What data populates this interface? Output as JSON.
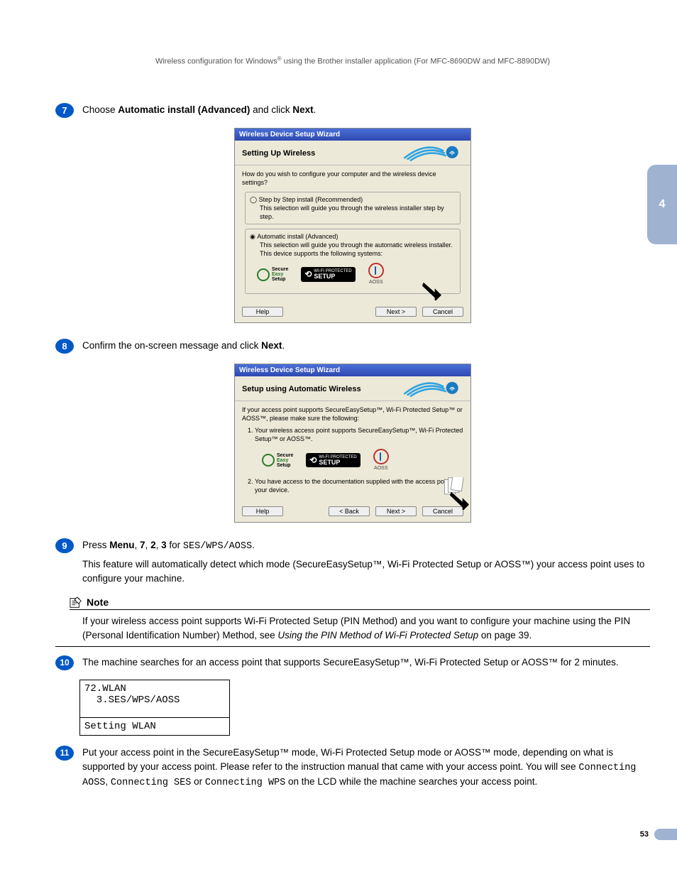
{
  "header": {
    "text_a": "Wireless configuration for Windows",
    "text_b": " using the Brother installer application (For MFC-8690DW and MFC-8890DW)"
  },
  "chapter_tab": "4",
  "page_number": "53",
  "steps": {
    "s7": {
      "num": "7",
      "text_a": "Choose ",
      "bold_a": "Automatic install (Advanced)",
      "text_b": " and click ",
      "bold_b": "Next",
      "text_c": "."
    },
    "s8": {
      "num": "8",
      "text_a": "Confirm the on-screen message and click ",
      "bold_a": "Next",
      "text_b": "."
    },
    "s9": {
      "num": "9",
      "line1_a": "Press ",
      "line1_b1": "Menu",
      "line1_sep1": ", ",
      "line1_b2": "7",
      "line1_sep2": ", ",
      "line1_b3": "2",
      "line1_sep3": ", ",
      "line1_b4": "3",
      "line1_c": " for ",
      "mono": "SES/WPS/AOSS",
      "line1_end": ".",
      "line2": "This feature will automatically detect which mode (SecureEasySetup™, Wi-Fi Protected Setup or AOSS™) your access point uses to configure your machine."
    },
    "s10": {
      "num": "10",
      "text": "The machine searches for an access point that supports SecureEasySetup™, Wi-Fi Protected Setup or AOSS™ for 2 minutes."
    },
    "s11": {
      "num": "11",
      "a": "Put your access point in the SecureEasySetup™ mode, Wi-Fi Protected Setup mode or AOSS™ mode, depending on what is supported by your access point. Please refer to the instruction manual that came with your access point. You will see ",
      "m1": "Connecting AOSS",
      "sep1": ", ",
      "m2": "Connecting SES",
      "sep2": " or ",
      "m3": "Connecting WPS",
      "b": " on the LCD while the machine searches your access point."
    }
  },
  "note": {
    "title": "Note",
    "a": "If your wireless access point supports Wi-Fi Protected Setup (PIN Method) and you want to configure your machine using the PIN (Personal Identification Number) Method, see ",
    "italic": "Using the PIN Method of Wi-Fi Protected Setup",
    "b": " on page 39."
  },
  "dialog1": {
    "title": "Wireless Device Setup Wizard",
    "heading": "Setting Up Wireless",
    "q": "How do you wish to configure your computer and the wireless device settings?",
    "opt1_label": "Step by Step install (Recommended)",
    "opt1_desc": "This selection will guide you through the wireless installer step by step.",
    "opt2_label": "Automatic install (Advanced)",
    "opt2_desc1": "This selection will guide you through the automatic wireless installer.",
    "opt2_desc2": "This device supports the following systems:",
    "btn_help": "Help",
    "btn_next": "Next >",
    "btn_cancel": "Cancel"
  },
  "dialog2": {
    "title": "Wireless Device Setup Wizard",
    "heading": "Setup using Automatic Wireless",
    "intro": "If your access point supports SecureEasySetup™, Wi-Fi Protected Setup™ or AOSS™, please make sure the following:",
    "item1": "Your wireless access point supports SecureEasySetup™, Wi-Fi Protected Setup™ or AOSS™.",
    "item2": "You have access to the documentation supplied with the access point and your device.",
    "btn_help": "Help",
    "btn_back": "< Back",
    "btn_next": "Next >",
    "btn_cancel": "Cancel"
  },
  "logos": {
    "ses1": "Secure",
    "ses2": "Easy",
    "ses3": "Setup",
    "wps1": "WI-FI PROTECTED",
    "wps2": "SETUP",
    "aoss": "AOSS"
  },
  "lcd": {
    "line1": "72.WLAN",
    "line2": "  3.SES/WPS/AOSS",
    "line3": "Setting WLAN"
  }
}
